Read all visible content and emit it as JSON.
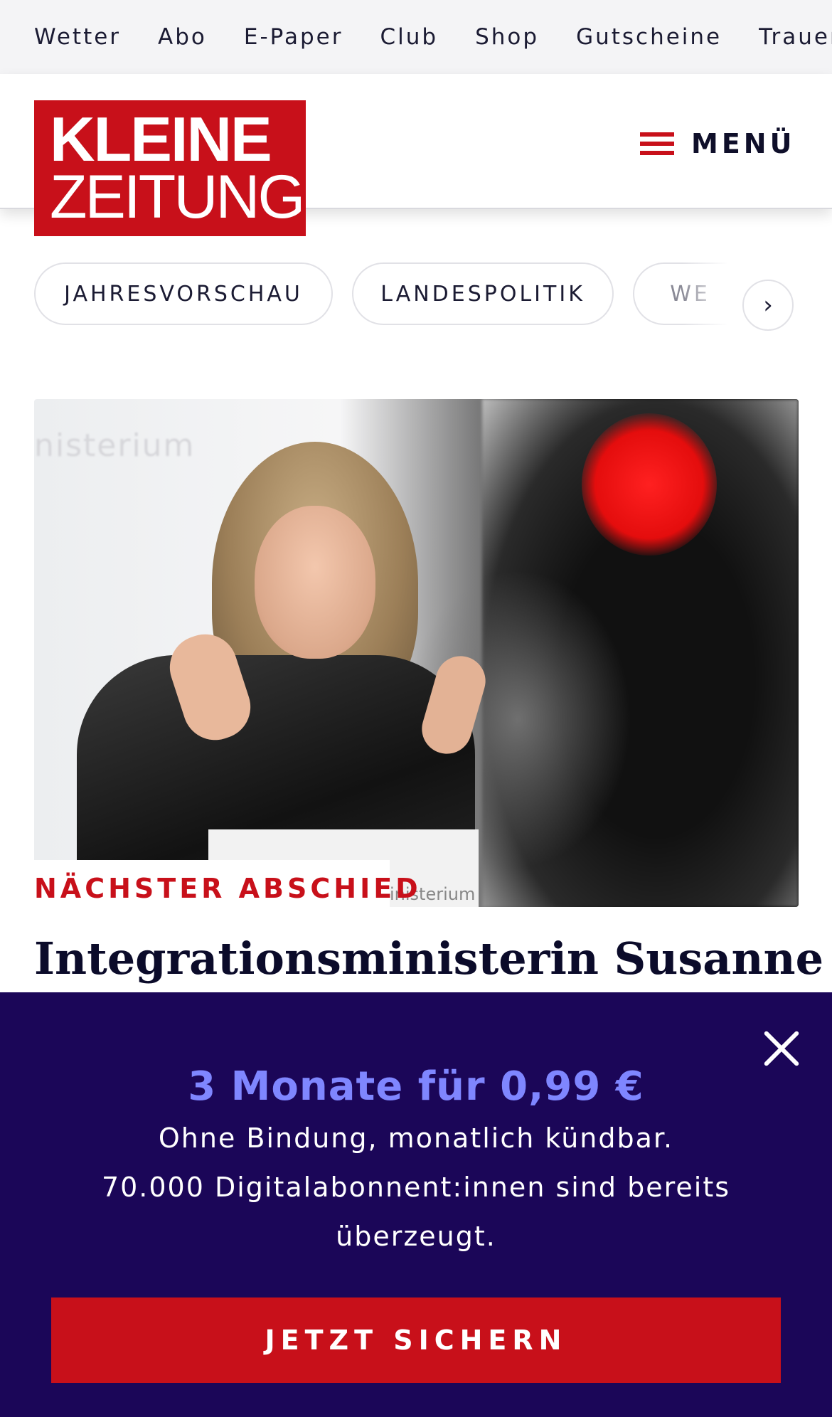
{
  "topnav": {
    "items": [
      "Wetter",
      "Abo",
      "E-Paper",
      "Club",
      "Shop",
      "Gutscheine",
      "Trauerp"
    ]
  },
  "header": {
    "logo_line1": "KLEINE",
    "logo_line2": "ZEITUNG",
    "menu_label": "MENÜ"
  },
  "pills": {
    "items": [
      "JAHRESVORSCHAU",
      "LANDESPOLITIK",
      "WE"
    ]
  },
  "hero": {
    "wall_text": "nisterium",
    "podium_text": "inisterium"
  },
  "article": {
    "kicker": "NÄCHSTER ABSCHIED",
    "headline": "Integrationsministerin Susanne"
  },
  "promo": {
    "offer": "3 Monate für 0,99 €",
    "line1": "Ohne Bindung, monatlich kündbar.",
    "line2": "70.000 Digitalabonnent:innen sind bereits",
    "line3": "überzeugt.",
    "cta": "JETZT SICHERN"
  },
  "colors": {
    "brand_red": "#c8101a",
    "promo_bg": "#1b0658",
    "promo_accent": "#7f86ff"
  }
}
